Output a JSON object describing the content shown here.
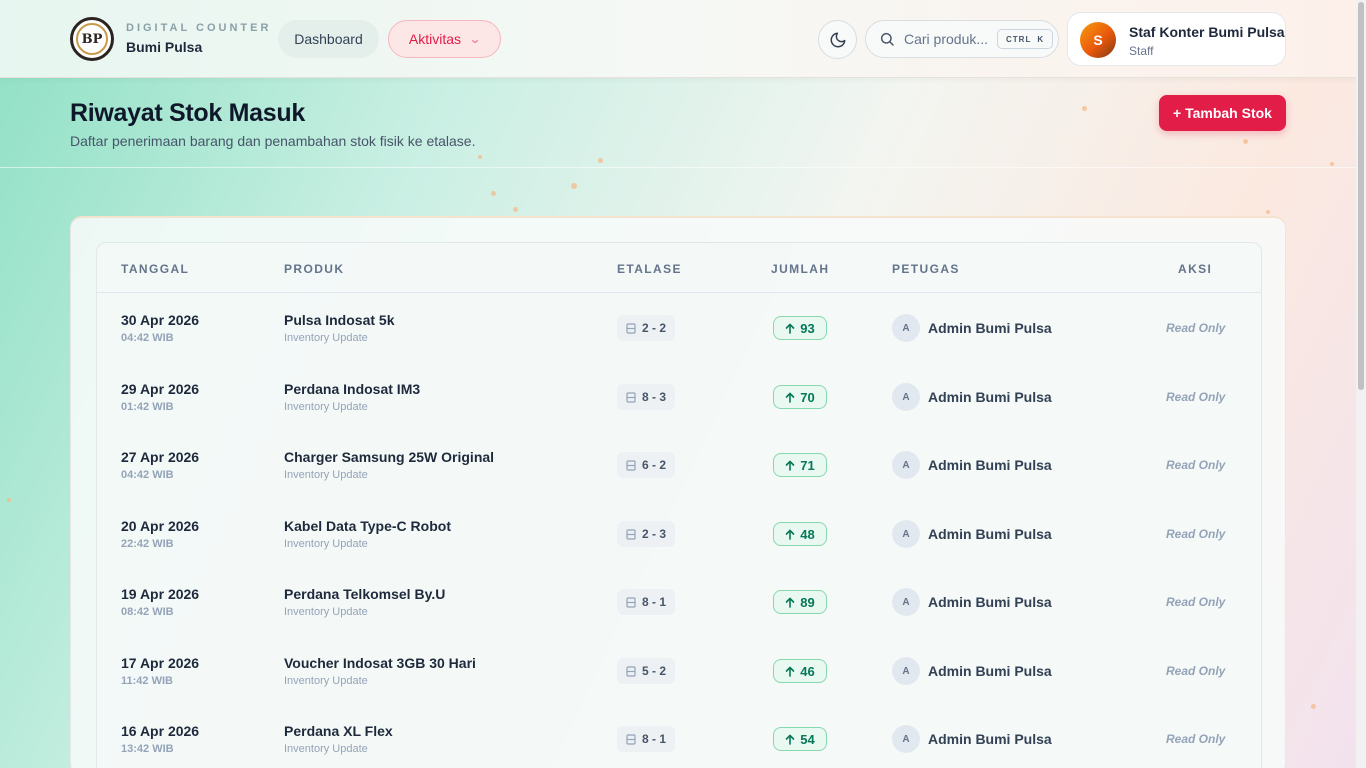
{
  "brand": {
    "tagline": "DIGITAL COUNTER",
    "name": "Bumi Pulsa",
    "logo_text": "BP"
  },
  "nav": {
    "dashboard_label": "Dashboard",
    "aktivitas_label": "Aktivitas"
  },
  "search": {
    "placeholder": "Cari produk...",
    "shortcut_ctrl": "CTRL",
    "shortcut_key": "K"
  },
  "user": {
    "initial": "S",
    "name": "Staf Konter Bumi Pulsa",
    "role": "Staff"
  },
  "page": {
    "title": "Riwayat Stok Masuk",
    "subtitle": "Daftar penerimaan barang dan penambahan stok fisik ke etalase.",
    "add_button_label": "+ Tambah Stok"
  },
  "table": {
    "headers": {
      "tanggal": "TANGGAL",
      "produk": "PRODUK",
      "etalase": "ETALASE",
      "jumlah": "JUMLAH",
      "petugas": "PETUGAS",
      "aksi": "AKSI"
    },
    "rows": [
      {
        "date": "30 Apr 2026",
        "time": "04:42 WIB",
        "product": "Pulsa Indosat 5k",
        "note": "Inventory Update",
        "etalase": "2 - 2",
        "qty": "93",
        "staff_initial": "A",
        "staff": "Admin Bumi Pulsa",
        "action": "Read Only"
      },
      {
        "date": "29 Apr 2026",
        "time": "01:42 WIB",
        "product": "Perdana Indosat IM3",
        "note": "Inventory Update",
        "etalase": "8 - 3",
        "qty": "70",
        "staff_initial": "A",
        "staff": "Admin Bumi Pulsa",
        "action": "Read Only"
      },
      {
        "date": "27 Apr 2026",
        "time": "04:42 WIB",
        "product": "Charger Samsung 25W Original",
        "note": "Inventory Update",
        "etalase": "6 - 2",
        "qty": "71",
        "staff_initial": "A",
        "staff": "Admin Bumi Pulsa",
        "action": "Read Only"
      },
      {
        "date": "20 Apr 2026",
        "time": "22:42 WIB",
        "product": "Kabel Data Type-C Robot",
        "note": "Inventory Update",
        "etalase": "2 - 3",
        "qty": "48",
        "staff_initial": "A",
        "staff": "Admin Bumi Pulsa",
        "action": "Read Only"
      },
      {
        "date": "19 Apr 2026",
        "time": "08:42 WIB",
        "product": "Perdana Telkomsel By.U",
        "note": "Inventory Update",
        "etalase": "8 - 1",
        "qty": "89",
        "staff_initial": "A",
        "staff": "Admin Bumi Pulsa",
        "action": "Read Only"
      },
      {
        "date": "17 Apr 2026",
        "time": "11:42 WIB",
        "product": "Voucher Indosat 3GB 30 Hari",
        "note": "Inventory Update",
        "etalase": "5 - 2",
        "qty": "46",
        "staff_initial": "A",
        "staff": "Admin Bumi Pulsa",
        "action": "Read Only"
      },
      {
        "date": "16 Apr 2026",
        "time": "13:42 WIB",
        "product": "Perdana XL Flex",
        "note": "Inventory Update",
        "etalase": "8 - 1",
        "qty": "54",
        "staff_initial": "A",
        "staff": "Admin Bumi Pulsa",
        "action": "Read Only"
      }
    ]
  },
  "icons": {
    "theme_toggle": "moon-icon",
    "search": "search-icon",
    "etalase": "shelf-icon",
    "qty": "arrow-up-icon",
    "nav_dropdown": "chevron-down-icon"
  },
  "colors": {
    "accent": "#e11d48",
    "success": "#047857",
    "success_bg": "#e9f8f0"
  }
}
